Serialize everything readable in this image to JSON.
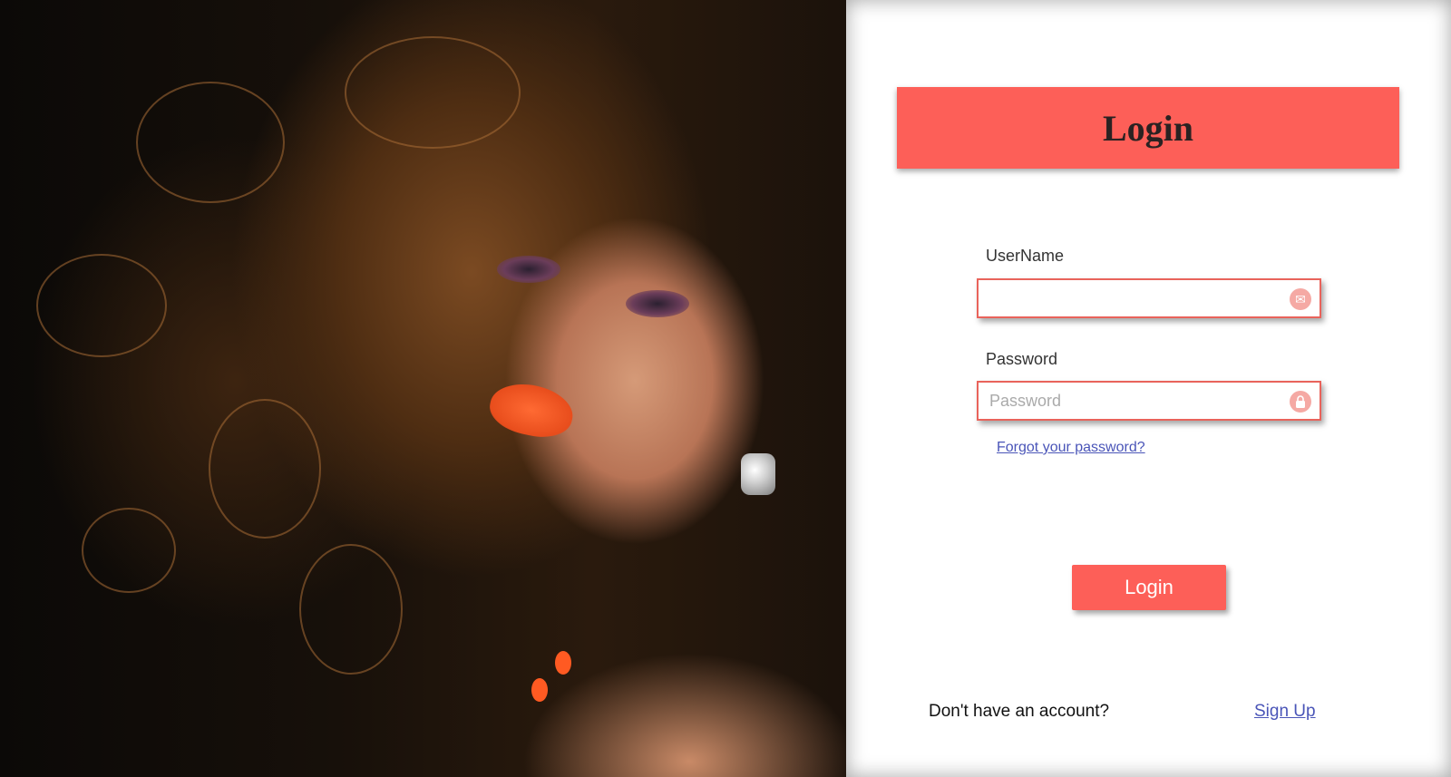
{
  "hero": {
    "image_alt": "Portrait of a woman with curly brown hair and orange lipstick"
  },
  "login_form": {
    "title": "Login",
    "username_label": "UserName",
    "username_value": "",
    "username_placeholder": "",
    "username_icon": "envelope-icon",
    "password_label": "Password",
    "password_value": "",
    "password_placeholder": "Password",
    "password_icon": "lock-icon",
    "forgot_password_link": "Forgot your password?",
    "submit_label": "Login",
    "signup_prompt": "Don't have an account?",
    "signup_link": "Sign Up"
  },
  "colors": {
    "accent": "#fd5f58",
    "field_border": "#e9635b",
    "link": "#4a55b8",
    "icon_bg": "#f5a9a4"
  }
}
